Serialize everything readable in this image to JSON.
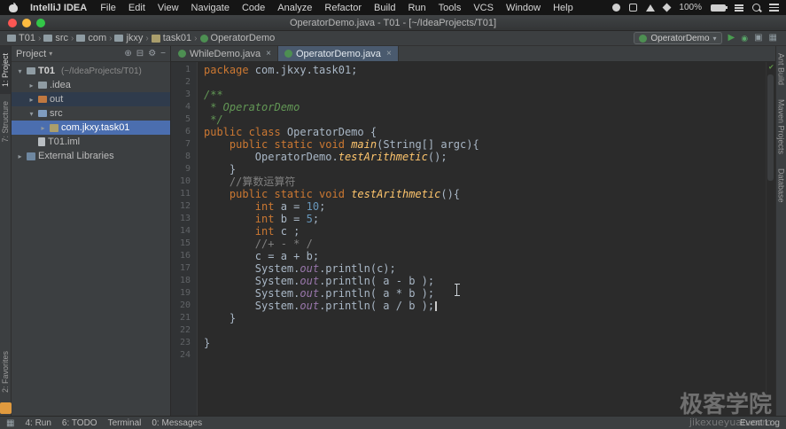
{
  "menubar": {
    "app_name": "IntelliJ IDEA",
    "menus": [
      "File",
      "Edit",
      "View",
      "Navigate",
      "Code",
      "Analyze",
      "Refactor",
      "Build",
      "Run",
      "Tools",
      "VCS",
      "Window",
      "Help"
    ],
    "battery": "100%"
  },
  "titlebar": {
    "title": "OperatorDemo.java - T01 - [~/IdeaProjects/T01]"
  },
  "navbar": {
    "breadcrumbs": [
      {
        "label": "T01",
        "icon": "folder"
      },
      {
        "label": "src",
        "icon": "folder"
      },
      {
        "label": "com",
        "icon": "folder"
      },
      {
        "label": "jkxy",
        "icon": "folder"
      },
      {
        "label": "task01",
        "icon": "package"
      },
      {
        "label": "OperatorDemo",
        "icon": "class"
      }
    ],
    "run_config": "OperatorDemo"
  },
  "tabs": [
    {
      "label": "WhileDemo.java",
      "active": false
    },
    {
      "label": "OperatorDemo.java",
      "active": true
    }
  ],
  "project_panel": {
    "header": "Project",
    "tree": [
      {
        "label": "T01",
        "hint": "(~/IdeaProjects/T01)",
        "depth": 0,
        "arrow": "down",
        "icon": "folder",
        "sel": "none",
        "root": true
      },
      {
        "label": ".idea",
        "depth": 1,
        "arrow": "right",
        "icon": "folder",
        "sel": "none"
      },
      {
        "label": "out",
        "depth": 1,
        "arrow": "right",
        "icon": "folder-excluded",
        "sel": "secondary"
      },
      {
        "label": "src",
        "depth": 1,
        "arrow": "down",
        "icon": "folder-src",
        "sel": "none"
      },
      {
        "label": "com.jkxy.task01",
        "depth": 2,
        "arrow": "right",
        "icon": "package",
        "sel": "primary"
      },
      {
        "label": "T01.iml",
        "depth": 1,
        "arrow": "none",
        "icon": "file",
        "sel": "none"
      },
      {
        "label": "External Libraries",
        "depth": 0,
        "arrow": "right",
        "icon": "library",
        "sel": "none"
      }
    ]
  },
  "left_toolbar": {
    "top": [
      {
        "label": "1: Project",
        "active": true
      },
      {
        "label": "7: Structure",
        "active": false
      }
    ],
    "bottom": [
      {
        "label": "2: Favorites",
        "active": false
      }
    ]
  },
  "right_toolbar": [
    "Ant Build",
    "Maven Projects",
    "Database"
  ],
  "editor": {
    "lines": [
      [
        [
          "kw",
          "package"
        ],
        [
          "plain",
          " com.jkxy.task01;"
        ]
      ],
      [],
      [
        [
          "javadoc",
          "/**"
        ]
      ],
      [
        [
          "javadoc",
          " * OperatorDemo"
        ]
      ],
      [
        [
          "javadoc",
          " */"
        ]
      ],
      [
        [
          "kw",
          "public class "
        ],
        [
          "plain",
          "OperatorDemo {"
        ]
      ],
      [
        [
          "plain",
          "    "
        ],
        [
          "kw",
          "public static void "
        ],
        [
          "smethod",
          "main"
        ],
        [
          "plain",
          "(String[] argc){"
        ]
      ],
      [
        [
          "plain",
          "        OperatorDemo."
        ],
        [
          "smethod",
          "testArithmetic"
        ],
        [
          "plain",
          "();"
        ]
      ],
      [
        [
          "plain",
          "    }"
        ]
      ],
      [
        [
          "plain",
          "    "
        ],
        [
          "comment",
          "//算数运算符"
        ]
      ],
      [
        [
          "plain",
          "    "
        ],
        [
          "kw",
          "public static void "
        ],
        [
          "smethod",
          "testArithmetic"
        ],
        [
          "plain",
          "(){"
        ]
      ],
      [
        [
          "plain",
          "        "
        ],
        [
          "kw",
          "int"
        ],
        [
          "plain",
          " a = "
        ],
        [
          "num",
          "10"
        ],
        [
          "plain",
          ";"
        ]
      ],
      [
        [
          "plain",
          "        "
        ],
        [
          "kw",
          "int"
        ],
        [
          "plain",
          " b = "
        ],
        [
          "num",
          "5"
        ],
        [
          "plain",
          ";"
        ]
      ],
      [
        [
          "plain",
          "        "
        ],
        [
          "kw",
          "int"
        ],
        [
          "plain",
          " c ;"
        ]
      ],
      [
        [
          "plain",
          "        "
        ],
        [
          "comment",
          "//+ - * /"
        ]
      ],
      [
        [
          "plain",
          "        c = a + b;"
        ]
      ],
      [
        [
          "plain",
          "        System."
        ],
        [
          "field",
          "out"
        ],
        [
          "plain",
          ".println(c);"
        ]
      ],
      [
        [
          "plain",
          "        System."
        ],
        [
          "field",
          "out"
        ],
        [
          "plain",
          ".println( a - b );"
        ]
      ],
      [
        [
          "plain",
          "        System."
        ],
        [
          "field",
          "out"
        ],
        [
          "plain",
          ".println( a * b );"
        ]
      ],
      [
        [
          "plain",
          "        System."
        ],
        [
          "field",
          "out"
        ],
        [
          "plain",
          ".println( a / b );"
        ],
        [
          "caret",
          ""
        ]
      ],
      [
        [
          "plain",
          "    }"
        ]
      ],
      [],
      [
        [
          "plain",
          "}"
        ]
      ],
      []
    ]
  },
  "statusbar": {
    "items": [
      "4: Run",
      "6: TODO",
      "Terminal",
      "0: Messages"
    ],
    "right": "Event Log"
  },
  "watermark": {
    "title": "极客学院",
    "subtitle": "jikexueyuan.com"
  },
  "icons": {
    "chevron_down": "▾",
    "chevron_right": "▸",
    "breadcrumb_separator": "›",
    "target": "⊕",
    "collapse_all": "⊟",
    "gear": "⚙",
    "hide": "−",
    "run": "▶",
    "debug": "◉",
    "coverage": "▣",
    "grid": "▦",
    "close": "×",
    "check": "✔",
    "switcher": "▦"
  },
  "colors": {
    "keyword": "#cc7832",
    "comment": "#808080",
    "javadoc": "#629755",
    "number": "#6897bb",
    "method": "#ffc66d",
    "field": "#9876aa",
    "selection": "#4b6eaf",
    "editor_bg": "#2b2b2b",
    "panel_bg": "#3c3f41"
  }
}
